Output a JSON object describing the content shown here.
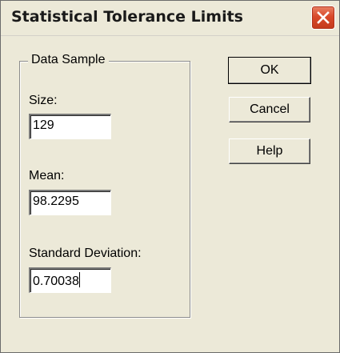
{
  "window": {
    "title": "Statistical Tolerance Limits"
  },
  "group": {
    "legend": "Data Sample",
    "size_label": "Size:",
    "size_value": "129",
    "mean_label": "Mean:",
    "mean_value": "98.2295",
    "sd_label": "Standard Deviation:",
    "sd_value": "0.70038"
  },
  "buttons": {
    "ok": "OK",
    "cancel": "Cancel",
    "help": "Help"
  },
  "icons": {
    "close": "close-icon"
  },
  "colors": {
    "dialog_bg": "#ece9d8",
    "close_button": "#d9492a"
  }
}
